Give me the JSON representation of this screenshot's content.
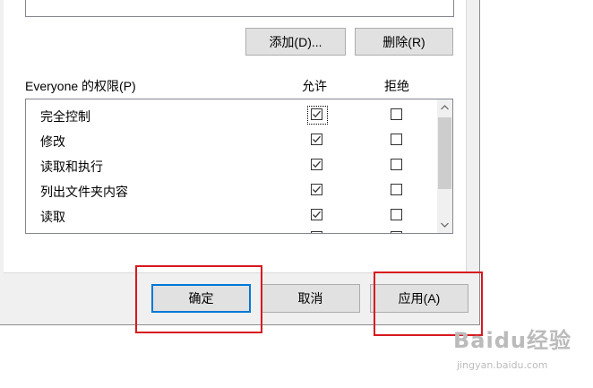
{
  "buttons": {
    "add_label": "添加(D)...",
    "remove_label": "删除(R)",
    "ok_label": "确定",
    "cancel_label": "取消",
    "apply_label": "应用(A)"
  },
  "permissions": {
    "title": "Everyone 的权限(P)",
    "allow_header": "允许",
    "deny_header": "拒绝",
    "rows": [
      {
        "name": "完全控制",
        "allow": true,
        "deny": false
      },
      {
        "name": "修改",
        "allow": true,
        "deny": false
      },
      {
        "name": "读取和执行",
        "allow": true,
        "deny": false
      },
      {
        "name": "列出文件夹内容",
        "allow": true,
        "deny": false
      },
      {
        "name": "读取",
        "allow": true,
        "deny": false
      }
    ]
  },
  "watermark": {
    "text": "Baidu经验",
    "url": "jingyan.baidu.com"
  },
  "colors": {
    "highlight": "#d7191f",
    "default_button_border": "#0078d7"
  }
}
